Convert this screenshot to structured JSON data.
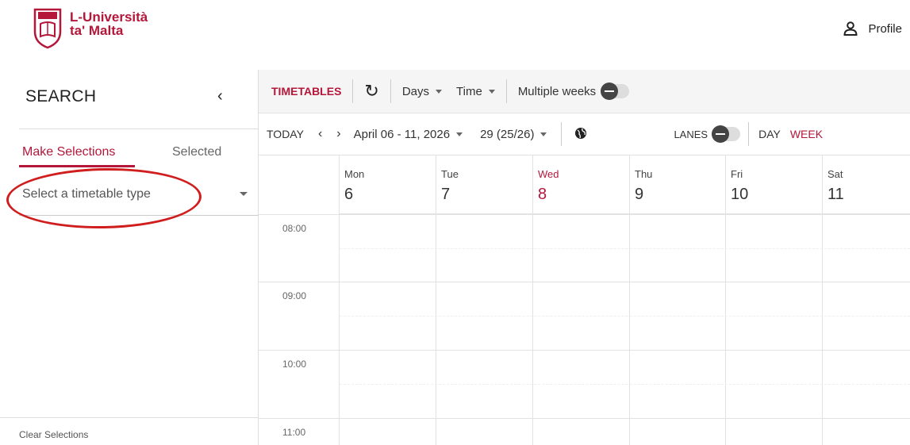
{
  "header": {
    "logo_line1": "L-Università",
    "logo_line2": "ta' Malta",
    "profile_label": "Profile"
  },
  "sidebar": {
    "title": "SEARCH",
    "tabs": [
      "Make Selections",
      "Selected"
    ],
    "select_placeholder": "Select a timetable type",
    "clear_label": "Clear Selections"
  },
  "toolbar": {
    "timetables_label": "TIMETABLES",
    "days_label": "Days",
    "time_label": "Time",
    "multiple_weeks_label": "Multiple weeks"
  },
  "nav": {
    "today_label": "TODAY",
    "date_range": "April 06 - 11, 2026",
    "week_label": "29 (25/26)",
    "lanes_label": "LANES",
    "day_label": "DAY",
    "week_view_label": "WEEK"
  },
  "calendar": {
    "days": [
      {
        "name": "Mon",
        "date": "6"
      },
      {
        "name": "Tue",
        "date": "7"
      },
      {
        "name": "Wed",
        "date": "8"
      },
      {
        "name": "Thu",
        "date": "9"
      },
      {
        "name": "Fri",
        "date": "10"
      },
      {
        "name": "Sat",
        "date": "11"
      }
    ],
    "hours": [
      "08:00",
      "09:00",
      "10:00",
      "11:00"
    ]
  },
  "colors": {
    "accent": "#b4173a",
    "highlight_ring": "#d01e1e"
  }
}
